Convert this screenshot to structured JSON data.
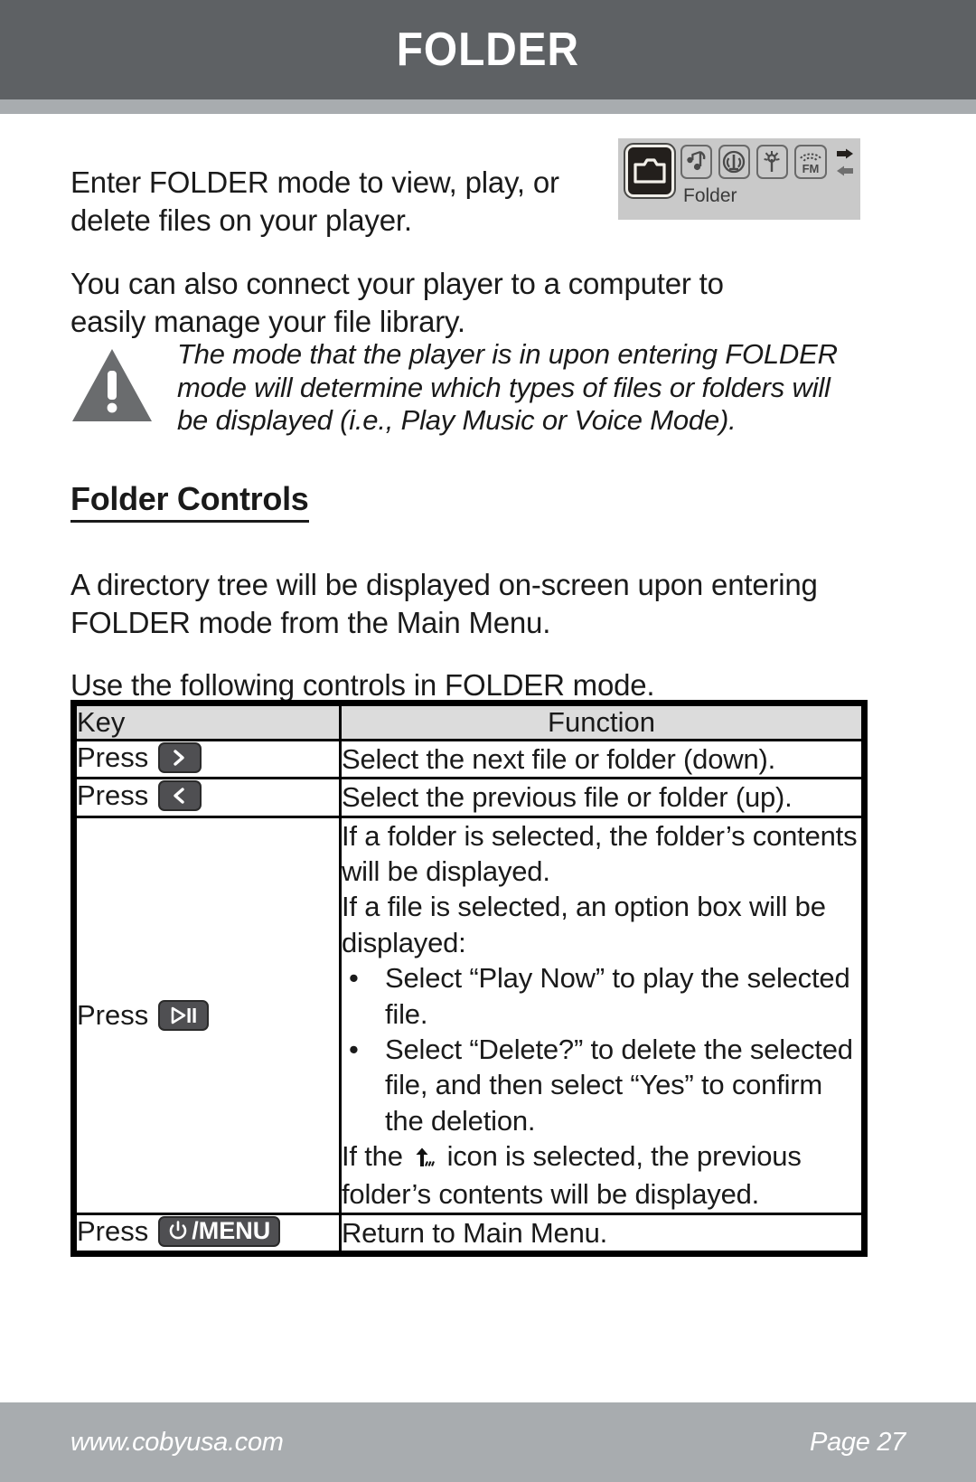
{
  "header": {
    "title": "FOLDER"
  },
  "intro": {
    "paragraph_1": "Enter FOLDER mode to view, play, or delete files on your player.",
    "paragraph_2": "You can also connect your player to a computer to easily manage your file library."
  },
  "lcd": {
    "label": "Folder",
    "icons": [
      {
        "name": "folder-icon",
        "selected": true
      },
      {
        "name": "music-note-icon",
        "selected": false
      },
      {
        "name": "microphone-icon",
        "selected": false
      },
      {
        "name": "antenna-icon",
        "selected": false
      },
      {
        "name": "fm-radio-icon",
        "selected": false
      }
    ],
    "scroll_arrows": "right-left-arrows"
  },
  "note": {
    "icon": "warning-triangle-icon",
    "text": "The mode that the player is in upon entering FOLDER mode will determine which types of files or folders will be displayed (i.e., Play Music or Voice Mode)."
  },
  "section": {
    "heading": "Folder Controls",
    "paragraph_1": "A directory tree will be displayed on-screen upon entering FOLDER mode from the Main Menu.",
    "paragraph_2": "Use the following controls in FOLDER mode."
  },
  "table": {
    "headers": {
      "key": "Key",
      "function": "Function"
    },
    "rows": [
      {
        "press_label": "Press",
        "key_glyph": "next-chevron-icon",
        "key_glyph_char": "›",
        "key_extra_text": "",
        "function_lines": [
          "Select the next file or folder (down)."
        ],
        "bullets": [],
        "trailing_lines": []
      },
      {
        "press_label": "Press",
        "key_glyph": "previous-chevron-icon",
        "key_glyph_char": "‹",
        "key_extra_text": "",
        "function_lines": [
          "Select the previous file or folder (up)."
        ],
        "bullets": [],
        "trailing_lines": []
      },
      {
        "press_label": "Press",
        "key_glyph": "play-pause-icon",
        "key_glyph_char": "",
        "key_extra_text": "",
        "function_lines": [
          "If a folder is selected, the folder’s contents will be displayed.",
          "If a file is selected, an option box will be displayed:"
        ],
        "bullets": [
          "Select “Play Now” to play the selected file.",
          "Select “Delete?” to delete the selected file, and then select “Yes” to confirm the deletion."
        ],
        "trailing_lines": [
          "If the ↑ icon is selected, the previous folder’s contents will be displayed."
        ],
        "trailing_prefix": "If the ",
        "trailing_suffix": " icon is selected, the previous folder’s contents will be displayed.",
        "trailing_icon": "up-one-level-folder-icon"
      },
      {
        "press_label": "Press",
        "key_glyph": "power-icon",
        "key_glyph_char": "⏻",
        "key_extra_text": "/MENU",
        "function_lines": [
          "Return to Main Menu."
        ],
        "bullets": [],
        "trailing_lines": []
      }
    ]
  },
  "footer": {
    "website": "www.cobyusa.com",
    "page": "Page 27"
  },
  "colors": {
    "header_bg": "#5e6164",
    "header_rule": "#a8acaf",
    "footer_bg": "#a8acaf",
    "table_header_bg": "#dcdcdc",
    "key_chip_bg": "#4f4f52",
    "lcd_bg": "#c9c9c9",
    "text": "#1a1a1a"
  }
}
